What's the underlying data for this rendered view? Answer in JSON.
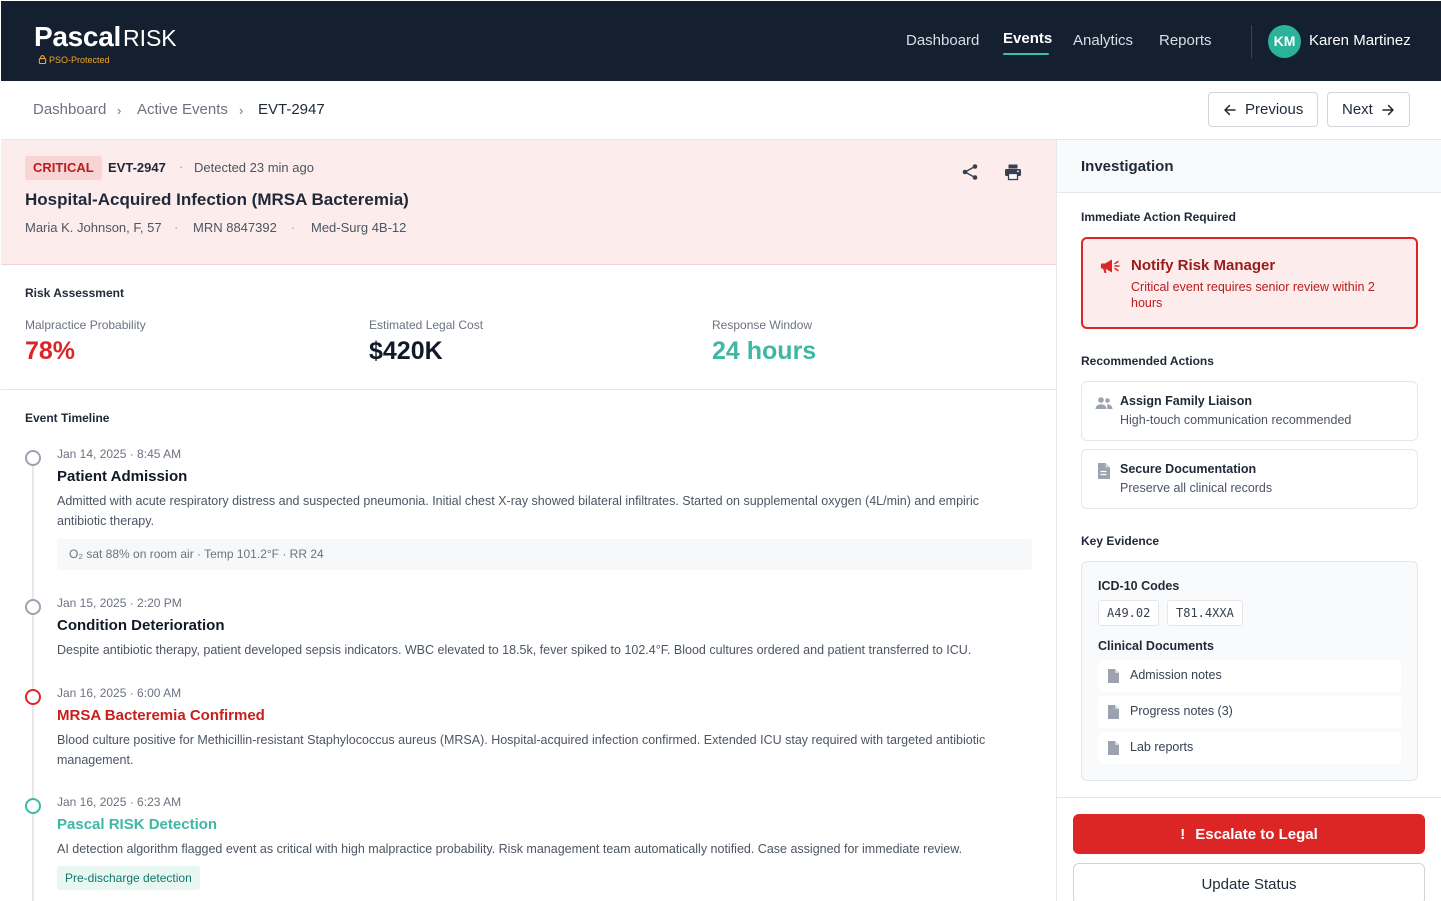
{
  "app": {
    "brand_name": "Pascal",
    "brand_suffix": "RISK",
    "brand_badge": "PSO-Protected",
    "nav": [
      {
        "label": "Dashboard",
        "active": false
      },
      {
        "label": "Events",
        "active": true
      },
      {
        "label": "Analytics",
        "active": false
      },
      {
        "label": "Reports",
        "active": false
      }
    ],
    "user": {
      "initials": "KM",
      "name": "Karen Martinez"
    }
  },
  "breadcrumb": {
    "items": [
      "Dashboard",
      "Active Events",
      "EVT-2947"
    ],
    "prev_label": "Previous",
    "next_label": "Next"
  },
  "event": {
    "severity": "CRITICAL",
    "id": "EVT-2947",
    "separator": "·",
    "detected": "Detected 23 min ago",
    "title": "Hospital-Acquired Infection (MRSA Bacteremia)",
    "patient": "Maria K. Johnson, F, 57",
    "mrn": "MRN 8847392",
    "unit": "Med-Surg 4B-12",
    "share_icon": "share-icon",
    "print_icon": "print-icon"
  },
  "risk": {
    "title": "Risk Assessment",
    "metrics": [
      {
        "label": "Malpractice Probability",
        "value": "78%",
        "color": "#dc2626"
      },
      {
        "label": "Estimated Legal Cost",
        "value": "$420K",
        "color": "#111827"
      },
      {
        "label": "Response Window",
        "value": "24 hours",
        "color": "#3fb8a3"
      }
    ]
  },
  "timeline": {
    "title": "Event Timeline",
    "events": [
      {
        "time": "Jan 14, 2025 · 8:45 AM",
        "title": "Patient Admission",
        "desc": "Admitted with acute respiratory distress and suspected pneumonia. Initial chest X-ray showed bilateral infiltrates. Started on supplemental oxygen (4L/min) and empiric antibiotic therapy.",
        "vitals": "O₂ sat 88% on room air · Temp 101.2°F · RR 24",
        "dot_color": "#9ca3af",
        "title_color": "#111827"
      },
      {
        "time": "Jan 15, 2025 · 2:20 PM",
        "title": "Condition Deterioration",
        "desc": "Despite antibiotic therapy, patient developed sepsis indicators. WBC elevated to 18.5k, fever spiked to 102.4°F. Blood cultures ordered and patient transferred to ICU.",
        "dot_color": "#9ca3af",
        "title_color": "#111827"
      },
      {
        "time": "Jan 16, 2025 · 6:00 AM",
        "title": "MRSA Bacteremia Confirmed",
        "desc": "Blood culture positive for Methicillin-resistant Staphylococcus aureus (MRSA). Hospital-acquired infection confirmed. Extended ICU stay required with targeted antibiotic management.",
        "dot_color": "#dc2626",
        "title_color": "#c81e1e"
      },
      {
        "time": "Jan 16, 2025 · 6:23 AM",
        "title": "Pascal RISK Detection",
        "desc": "AI detection algorithm flagged event as critical with high malpractice probability. Risk management team automatically notified. Case assigned for immediate review.",
        "tag": "Pre-discharge detection",
        "dot_color": "#3fb8a3",
        "title_color": "#3fb8a3"
      }
    ]
  },
  "panel": {
    "title": "Investigation",
    "immediate_title": "Immediate Action Required",
    "alert": {
      "icon": "megaphone-icon",
      "title": "Notify Risk Manager",
      "desc": "Critical event requires senior review within 2 hours"
    },
    "recommended_title": "Recommended Actions",
    "actions": [
      {
        "icon": "people-icon",
        "title": "Assign Family Liaison",
        "sub": "High-touch communication recommended"
      },
      {
        "icon": "document-icon",
        "title": "Secure Documentation",
        "sub": "Preserve all clinical records"
      }
    ],
    "evidence_title": "Key Evidence",
    "icd_label": "ICD-10 Codes",
    "codes": [
      "A49.02",
      "T81.4XXA"
    ],
    "docs_label": "Clinical Documents",
    "documents": [
      "Admission notes",
      "Progress notes (3)",
      "Lab reports"
    ],
    "escalate_label": "Escalate to Legal",
    "escalate_icon": "!",
    "update_label": "Update Status"
  },
  "colors": {
    "nav_bg": "#14202f",
    "accent": "#3fbfa6",
    "critical": "#dc2626",
    "critical_bg": "#fdecec"
  }
}
